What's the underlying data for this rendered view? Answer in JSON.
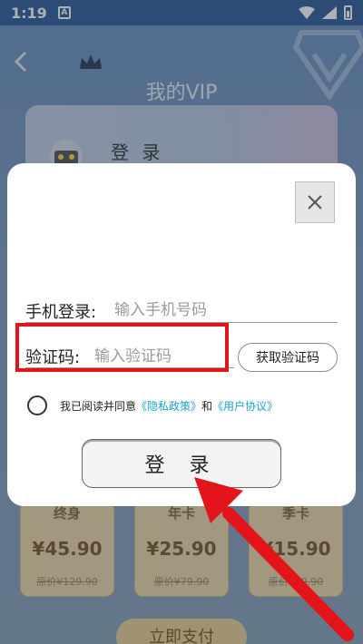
{
  "status_bar": {
    "time": "1:19",
    "notification_badge": "A"
  },
  "header": {
    "title": "我的VIP"
  },
  "vip_card": {
    "login_text": "登 录"
  },
  "plans": [
    {
      "name": "终身",
      "price": "¥45.90",
      "original": "原价¥129.90"
    },
    {
      "name": "年卡",
      "price": "¥25.90",
      "original": "原价¥79.90"
    },
    {
      "name": "季卡",
      "price": "¥15.90",
      "original": "原价¥39.90"
    }
  ],
  "pay_button": "立即支付",
  "dialog": {
    "close_icon": "close-icon",
    "phone_label": "手机登录:",
    "phone_placeholder": "输入手机号码",
    "code_label": "验证码:",
    "code_placeholder": "输入验证码",
    "get_code_button": "获取验证码",
    "agree_text": "我已阅读并同意",
    "privacy_link": "《隐私政策》",
    "and_text": "和",
    "user_agreement_link": "《用户协议》",
    "login_button": "登 录"
  },
  "annotation": {
    "highlight_color": "#e3141a",
    "arrow_color": "#e3141a"
  }
}
